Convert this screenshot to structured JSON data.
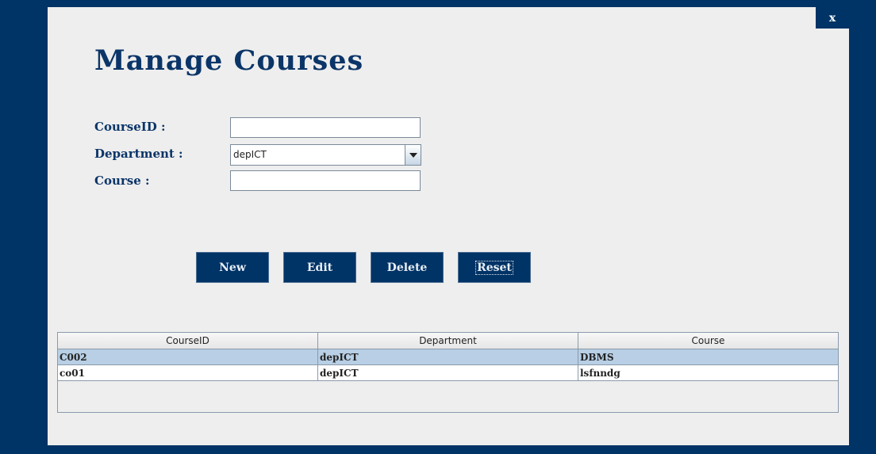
{
  "window": {
    "close_label": "x"
  },
  "page": {
    "title": "Manage Courses"
  },
  "form": {
    "course_id_label": "CourseID :",
    "course_id_value": "",
    "department_label": "Department :",
    "department_value": "depICT",
    "course_label": "Course :",
    "course_value": ""
  },
  "buttons": {
    "new": "New",
    "edit": "Edit",
    "delete": "Delete",
    "reset": "Reset"
  },
  "table": {
    "columns": [
      "CourseID",
      "Department",
      "Course"
    ],
    "rows": [
      [
        "C002",
        "depICT",
        "DBMS"
      ],
      [
        "co01",
        "depICT",
        "lsfnndg"
      ]
    ],
    "selected_row": 0
  },
  "colors": {
    "background": "#003366",
    "panel": "#eeeeee",
    "title": "#0b3568",
    "button": "#003366",
    "selected_row": "#b8cfe5"
  }
}
